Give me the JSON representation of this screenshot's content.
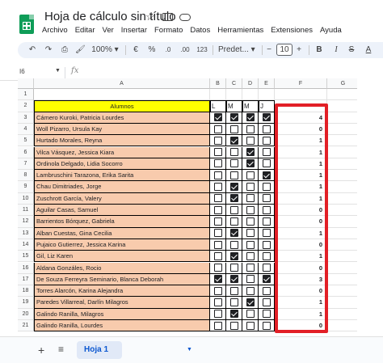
{
  "app": {
    "title": "Hoja de cálculo sin título",
    "menu": [
      "Archivo",
      "Editar",
      "Ver",
      "Insertar",
      "Formato",
      "Datos",
      "Herramientas",
      "Extensiones",
      "Ayuda"
    ]
  },
  "toolbar": {
    "zoom": "100%",
    "currency": "€",
    "percent": "%",
    "dec_decrease": ".0",
    "dec_increase": ".00",
    "number_format": "123",
    "font": "Predet...",
    "font_size": "10",
    "minus": "−",
    "plus": "+",
    "bold": "B"
  },
  "formula_bar": {
    "cell_ref": "I6",
    "fx": "fx"
  },
  "columns": [
    "A",
    "B",
    "C",
    "D",
    "E",
    "F",
    "G"
  ],
  "row_numbers": [
    "1",
    "2",
    "3",
    "4",
    "5",
    "6",
    "7",
    "8",
    "9",
    "10",
    "11",
    "12",
    "13",
    "14",
    "15",
    "16",
    "17",
    "18",
    "19",
    "20",
    "21"
  ],
  "header_row": {
    "students_label": "Alumnos",
    "days": [
      "L",
      "M",
      "M",
      "J"
    ]
  },
  "students": [
    {
      "name": "Cámero Kuroki, Patricia Lourdes",
      "checks": [
        true,
        true,
        true,
        true
      ],
      "count": "4"
    },
    {
      "name": "Woll Pizarro, Ursula Kay",
      "checks": [
        false,
        false,
        false,
        false
      ],
      "count": "0"
    },
    {
      "name": "Hurtado Morales, Reyna",
      "checks": [
        false,
        true,
        false,
        false
      ],
      "count": "1"
    },
    {
      "name": "Vilca Vásquez, Jessica Kiara",
      "checks": [
        false,
        false,
        true,
        false
      ],
      "count": "1"
    },
    {
      "name": "Ordinola Delgado, Lidia Socorro",
      "checks": [
        false,
        false,
        true,
        false
      ],
      "count": "1"
    },
    {
      "name": "Lambruschini Tarazona, Erika Sarita",
      "checks": [
        false,
        false,
        false,
        true
      ],
      "count": "1"
    },
    {
      "name": "Chau Dimitriades, Jorge",
      "checks": [
        false,
        true,
        false,
        false
      ],
      "count": "1"
    },
    {
      "name": "Zuschrott García, Valery",
      "checks": [
        false,
        true,
        false,
        false
      ],
      "count": "1"
    },
    {
      "name": "Aguilar Casas, Samuel",
      "checks": [
        false,
        false,
        false,
        false
      ],
      "count": "0"
    },
    {
      "name": "Barrientos Bórquez, Gabriela",
      "checks": [
        false,
        false,
        false,
        false
      ],
      "count": "0"
    },
    {
      "name": "Alban Cuestas, Gina Cecilia",
      "checks": [
        false,
        true,
        false,
        false
      ],
      "count": "1"
    },
    {
      "name": "Pujaico Gutierrez, Jessica Karina",
      "checks": [
        false,
        false,
        false,
        false
      ],
      "count": "0"
    },
    {
      "name": "Gil, Liz Karen",
      "checks": [
        false,
        true,
        false,
        false
      ],
      "count": "1"
    },
    {
      "name": "Aldana Gonzáles, Rocio",
      "checks": [
        false,
        false,
        false,
        false
      ],
      "count": "0"
    },
    {
      "name": "De Souza Ferreyra Seminario, Blanca Deborah",
      "checks": [
        true,
        true,
        false,
        true
      ],
      "count": "3"
    },
    {
      "name": "Torres Alarcón, Karina Alejandra",
      "checks": [
        false,
        false,
        false,
        false
      ],
      "count": "0"
    },
    {
      "name": "Paredes Villarreal, Darlín Milagros",
      "checks": [
        false,
        false,
        true,
        false
      ],
      "count": "1"
    },
    {
      "name": "Galindo Ranilla, Milagros",
      "checks": [
        false,
        true,
        false,
        false
      ],
      "count": "1"
    },
    {
      "name": "Galindo Ranilla, Lourdes",
      "checks": [
        false,
        false,
        false,
        false
      ],
      "count": "0"
    }
  ],
  "sheet_tabs": {
    "active": "Hoja 1"
  },
  "colors": {
    "name_fill": "#f8cbad",
    "header_fill": "#ffff00",
    "highlight_box": "#e21f26",
    "sheets_green": "#0f9d58"
  }
}
